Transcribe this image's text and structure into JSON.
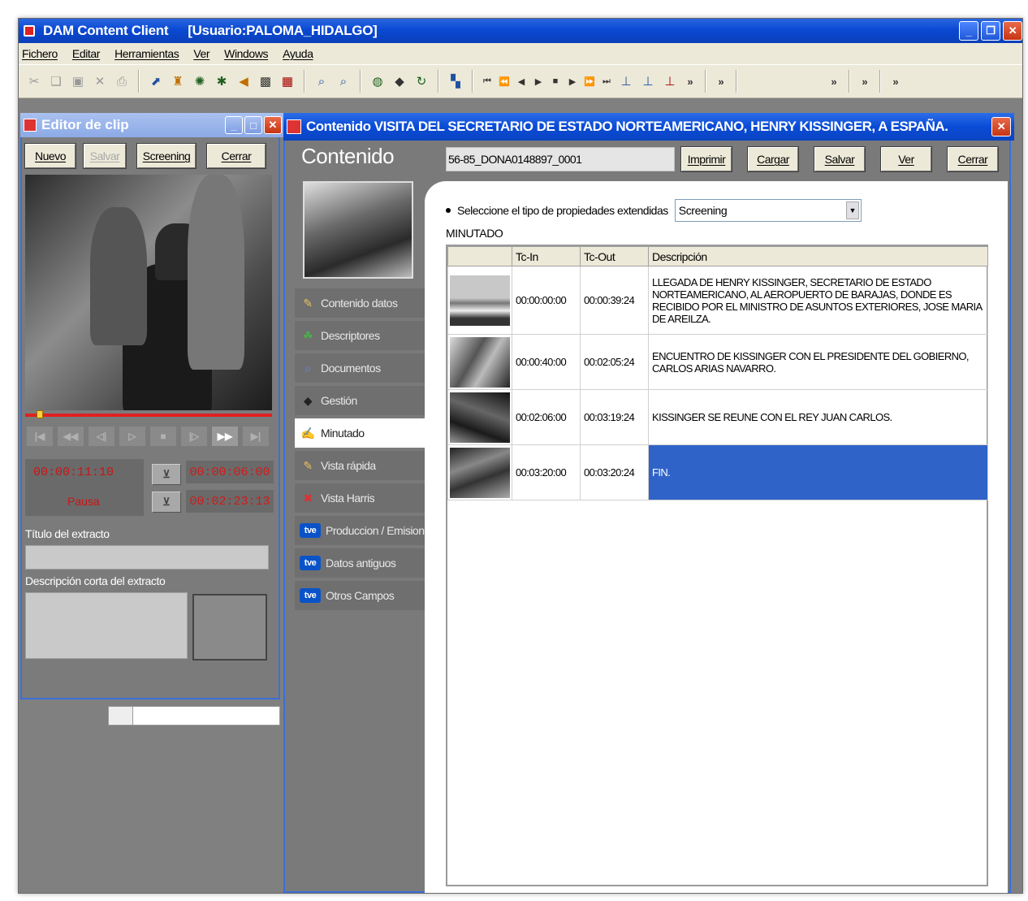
{
  "app": {
    "title": "DAM Content Client",
    "user": "[Usuario:PALOMA_HIDALGO]"
  },
  "menu": [
    "Fichero",
    "Editar",
    "Herramientas",
    "Ver",
    "Windows",
    "Ayuda"
  ],
  "clip_editor": {
    "title": "Editor de clip",
    "buttons": {
      "new": "Nuevo",
      "save": "Salvar",
      "screening": "Screening",
      "close": "Cerrar"
    },
    "timecode_current": "00:00:11:10",
    "timecode_mark_in": "00:00:06:00",
    "timecode_mark_out": "00:02:23:13",
    "state": "Pausa",
    "excerpt_title_label": "Título del extracto",
    "excerpt_title_value": "",
    "excerpt_desc_label": "Descripción corta del extracto",
    "excerpt_desc_value": ""
  },
  "content_window": {
    "title": "Contenido VISITA DEL SECRETARIO DE ESTADO NORTEAMERICANO, HENRY KISSINGER, A ESPAÑA.",
    "header": "Contenido",
    "id_value": "56-85_DONA0148897_0001",
    "buttons": {
      "print": "Imprimir",
      "load": "Cargar",
      "save": "Salvar",
      "view": "Ver",
      "close": "Cerrar"
    },
    "nav": [
      {
        "label": "Contenido datos",
        "icon": "content-data-icon",
        "glyph": "✎"
      },
      {
        "label": "Descriptores",
        "icon": "descriptors-icon",
        "glyph": "☘"
      },
      {
        "label": "Documentos",
        "icon": "documents-icon",
        "glyph": "🔍"
      },
      {
        "label": "Gestión",
        "icon": "management-icon",
        "glyph": "◆"
      },
      {
        "label": "Minutado",
        "icon": "minutado-icon",
        "glyph": "✍"
      },
      {
        "label": "Vista rápida",
        "icon": "quick-view-icon",
        "glyph": "✎"
      },
      {
        "label": "Vista Harris",
        "icon": "harris-view-icon",
        "glyph": "✖"
      },
      {
        "label": "Produccion / Emision",
        "icon": "tve-logo-icon",
        "glyph": "tve"
      },
      {
        "label": "Datos antiguos",
        "icon": "tve-logo-icon",
        "glyph": "tve"
      },
      {
        "label": "Otros Campos",
        "icon": "tve-logo-icon",
        "glyph": "tve"
      }
    ],
    "selector_label": "Seleccione el tipo de propiedades extendidas",
    "selector_value": "Screening",
    "section_label": "MINUTADO",
    "columns": [
      "Tc-In",
      "Tc-Out",
      "Descripción"
    ],
    "rows": [
      {
        "tc_in": "00:00:00:00",
        "tc_out": "00:00:39:24",
        "desc": "LLEGADA DE HENRY KISSINGER, SECRETARIO DE ESTADO NORTEAMERICANO, AL AEROPUERTO DE BARAJAS, DONDE ES RECIBIDO POR EL MINISTRO DE ASUNTOS EXTERIORES, JOSE MARIA DE AREILZA."
      },
      {
        "tc_in": "00:00:40:00",
        "tc_out": "00:02:05:24",
        "desc": "ENCUENTRO DE KISSINGER CON EL PRESIDENTE DEL GOBIERNO, CARLOS ARIAS NAVARRO."
      },
      {
        "tc_in": "00:02:06:00",
        "tc_out": "00:03:19:24",
        "desc": "KISSINGER SE REUNE CON EL REY JUAN CARLOS."
      },
      {
        "tc_in": "00:03:20:00",
        "tc_out": "00:03:20:24",
        "desc": "FIN."
      }
    ]
  },
  "colors": {
    "title_blue": "#0a4bd6",
    "selection": "#2f63c8",
    "timecode_red": "#c91515"
  }
}
